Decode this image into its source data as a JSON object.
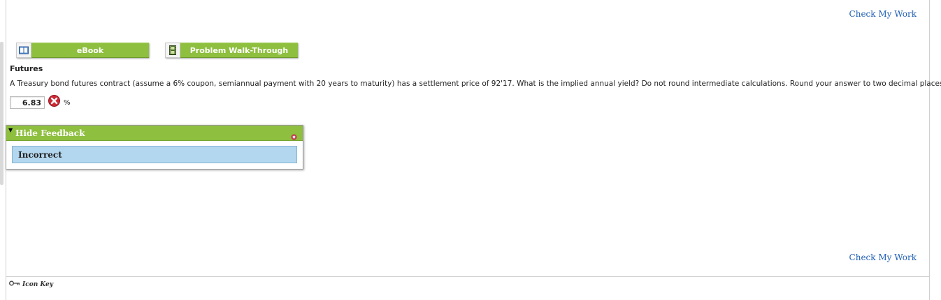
{
  "header": {
    "check_my_work_label": "Check My Work"
  },
  "footer": {
    "check_my_work_label": "Check My Work",
    "icon_key_label": "Icon Key",
    "icon": "key-icon"
  },
  "toolbar": {
    "ebook": {
      "label": "eBook",
      "icon": "book-icon"
    },
    "walkthrough": {
      "label": "Problem Walk-Through",
      "icon": "film-icon"
    },
    "accent": "#8ebf3f"
  },
  "problem": {
    "title": "Futures",
    "question": "A Treasury bond futures contract (assume a 6% coupon, semiannual payment with 20 years to maturity) has a settlement price of 92'17. What is the implied annual yield? Do not round intermediate calculations. Round your answer to two decimal places.",
    "answer_value": "6.83",
    "unit": "%",
    "status_icon": "incorrect-x-icon",
    "status_color": "#cc2a36"
  },
  "feedback": {
    "toggle_label": "Hide Feedback",
    "result": "Incorrect",
    "result_bg": "#b3d7ee"
  }
}
